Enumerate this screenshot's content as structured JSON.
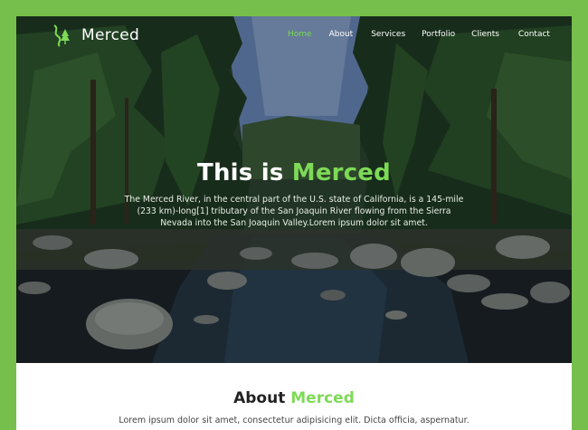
{
  "brand": {
    "name": "Merced",
    "logo_icon": "river-trees-logo-icon",
    "accent_color": "#7ed957",
    "frame_color": "#76bf4c"
  },
  "nav": {
    "items": [
      {
        "label": "Home",
        "active": true
      },
      {
        "label": "About",
        "active": false
      },
      {
        "label": "Services",
        "active": false
      },
      {
        "label": "Portfolio",
        "active": false
      },
      {
        "label": "Clients",
        "active": false
      },
      {
        "label": "Contact",
        "active": false
      }
    ]
  },
  "hero": {
    "title_prefix": "This is ",
    "title_accent": "Merced",
    "description": "The Merced River, in the central part of the U.S. state of California, is a 145-mile (233 km)-long[1] tributary of the San Joaquin River flowing from the Sierra Nevada into the San Joaquin Valley.Lorem ipsum dolor sit amet."
  },
  "about": {
    "title_prefix": "About ",
    "title_accent": "Merced",
    "text": "Lorem ipsum dolor sit amet, consectetur adipisicing elit. Dicta officia, aspernatur."
  }
}
